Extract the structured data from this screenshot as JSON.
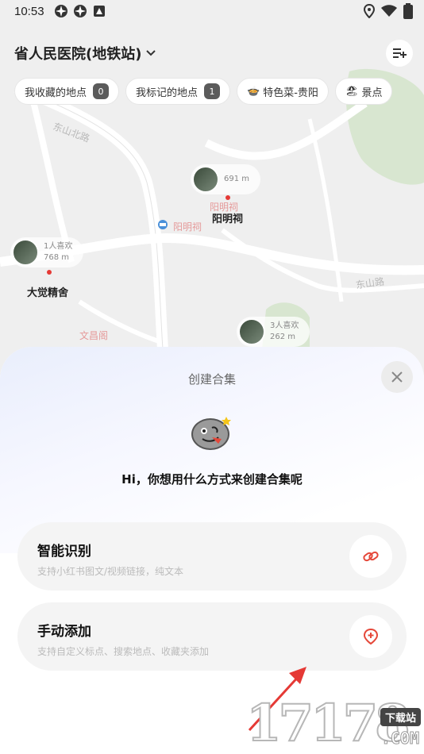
{
  "status_bar": {
    "time": "10:53"
  },
  "header": {
    "title": "省人民医院(地铁站)"
  },
  "chips": [
    {
      "label": "我收藏的地点",
      "count": "0"
    },
    {
      "label": "我标记的地点",
      "count": "1"
    },
    {
      "label": "特色菜-贵阳",
      "emoji": "🍲"
    },
    {
      "label": "景点",
      "emoji": "🏖"
    }
  ],
  "map": {
    "street_labels": [
      "东山北路",
      "东山路",
      "阳明祠",
      "阳明祠",
      "文昌阁"
    ],
    "pois": [
      {
        "name": "阳明祠",
        "distance": "691 m",
        "likes": ""
      },
      {
        "name": "大觉精舍",
        "distance": "768 m",
        "likes": "1人喜欢"
      },
      {
        "name": "",
        "distance": "262 m",
        "likes": "3人喜欢"
      }
    ]
  },
  "sheet": {
    "title": "创建合集",
    "greeting": "Hi，你想用什么方式来创建合集呢",
    "options": [
      {
        "title": "智能识别",
        "desc": "支持小红书图文/视频链接，纯文本",
        "icon": "link-icon"
      },
      {
        "title": "手动添加",
        "desc": "支持自定义标点、搜索地点、收藏夹添加",
        "icon": "add-location-icon"
      }
    ]
  },
  "watermark": {
    "number": "17178",
    "badge": "下载站",
    "suffix": ".COM"
  },
  "colors": {
    "accent": "#e5483a",
    "chip_count_bg": "#5b5b5b",
    "sheet_option_bg": "#f4f4f4"
  }
}
